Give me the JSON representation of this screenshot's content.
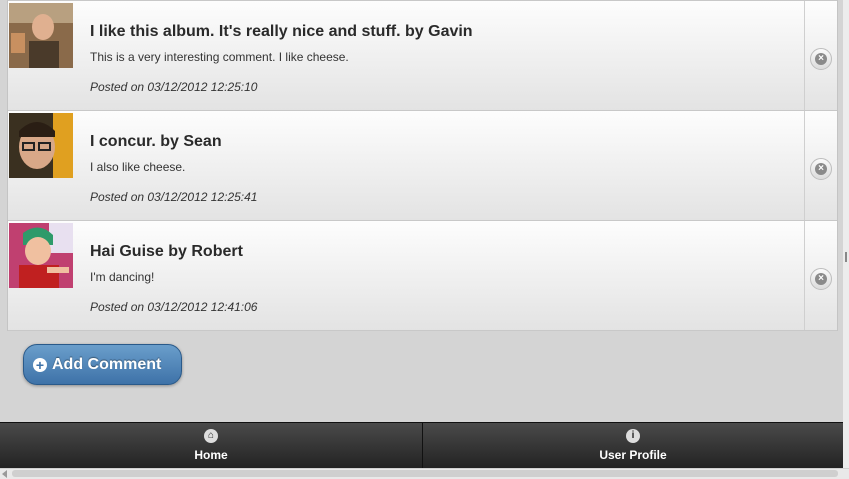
{
  "comments": [
    {
      "title": "I like this album. It's really nice and stuff. by Gavin",
      "body": "This is a very interesting comment. I like cheese.",
      "posted": "Posted on 03/12/2012 12:25:10"
    },
    {
      "title": "I concur. by Sean",
      "body": "I also like cheese.",
      "posted": "Posted on 03/12/2012 12:25:41"
    },
    {
      "title": "Hai Guise by Robert",
      "body": "I'm dancing!",
      "posted": "Posted on 03/12/2012 12:41:06"
    }
  ],
  "add_comment": {
    "label": "Add Comment",
    "icon": "plus-icon"
  },
  "navbar": {
    "home": {
      "label": "Home",
      "icon": "home-icon"
    },
    "profile": {
      "label": "User Profile",
      "icon": "info-icon"
    }
  },
  "colors": {
    "accent": "#3e72a8",
    "navbar": "#2a2a2a"
  }
}
